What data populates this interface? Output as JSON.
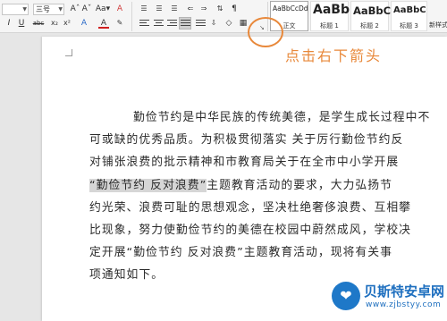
{
  "ribbon": {
    "font_size_value": "",
    "font_size_combo2": "三号",
    "row1_buttons": [
      "Aˆ",
      "Aˇ",
      "Aa▾",
      "A"
    ],
    "row2_buttons": [
      "I",
      "U",
      "abc",
      "x₂",
      "x²",
      "A",
      "A"
    ],
    "paragraph_row1_buttons": [
      "☰",
      "☰",
      "☰",
      "⇐",
      "⇒"
    ],
    "paragraph_row2_buttons": [
      "≡",
      "≡",
      "≡",
      "≡",
      "≡",
      "⇩",
      "◇",
      "▦"
    ],
    "styles": [
      {
        "sample": "AaBbCcDd",
        "name": "正文"
      },
      {
        "sample": "AaBb",
        "name": "标题 1"
      },
      {
        "sample": "AaBbC",
        "name": "标题 2"
      },
      {
        "sample": "AaBbC",
        "name": "标题 3"
      },
      {
        "sample": "",
        "name": "新样式"
      }
    ],
    "launcher_glyph": "↘"
  },
  "annotation": {
    "text": "点击右下箭头",
    "color": "#e8883a"
  },
  "document": {
    "lines": [
      "勤俭节约是中华民族的传统美德，是学生成长过程中不",
      "可或缺的优秀品质。为积极贯彻落实 关于厉行勤俭节约反",
      "对铺张浪费的批示精神和市教育局关于在全市中小学开展",
      "“勤俭节约 反对浪费”",
      "主题教育活动的要求，大力弘扬节",
      "约光荣、浪费可耻的思想观念，坚决杜绝奢侈浪费、互相攀",
      "比现象，努力使勤俭节约的美德在校园中蔚然成风，学校决",
      "定开展“勤俭节约 反对浪费”主题教育活动，现将有关事",
      "项通知如下。"
    ],
    "highlight_color": "#d6d6d6"
  },
  "watermark": {
    "logo_glyph": "❤",
    "title": "贝斯特安卓网",
    "url": "www.zjbstyy.com"
  }
}
